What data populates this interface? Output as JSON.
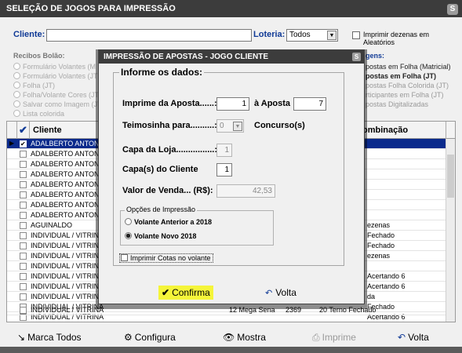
{
  "window": {
    "title": "SELEÇÃO DE JOGOS PARA IMPRESSÃO",
    "close_icon": "S"
  },
  "filters": {
    "cliente_label": "Cliente:",
    "cliente_value": "",
    "loteria_label": "Loteria:",
    "loteria_value": "Todos",
    "aleatorios_label": "Imprimir dezenas em Aleatórios"
  },
  "recibos": {
    "title": "Recibos Bolão:",
    "items": [
      "Formulário Volantes (M",
      "Formulário Volantes (JT",
      "Folha (JT)",
      "Folha/Volante Cores (JT",
      "Salvar como Imagem (JT",
      "Lista colorida"
    ]
  },
  "right_options": {
    "title_fragment": "gens:",
    "items": [
      "postas em Folha (Matricial)",
      "postas em Folha (JT)",
      "postas Folha Colorida (JT)",
      "rticipantes em Folha (JT)",
      "postas Digitalizadas"
    ]
  },
  "grid": {
    "headers": {
      "cliente": "Cliente",
      "combinacao": "ombinação"
    },
    "rows": [
      {
        "name": "ADALBERTO ANTONIO",
        "right": "",
        "selected": true
      },
      {
        "name": "ADALBERTO ANTONIO",
        "right": ""
      },
      {
        "name": "ADALBERTO ANTONIO",
        "right": ""
      },
      {
        "name": "ADALBERTO ANTONIO",
        "right": ""
      },
      {
        "name": "ADALBERTO ANTONIO",
        "right": ""
      },
      {
        "name": "ADALBERTO ANTONIO",
        "right": ""
      },
      {
        "name": "ADALBERTO ANTONIO",
        "right": ""
      },
      {
        "name": "ADALBERTO ANTONIO",
        "right": ""
      },
      {
        "name": "AGUINALDO",
        "right": "ezenas"
      },
      {
        "name": "INDIVIDUAL / VITRINA",
        "right": "Fechado"
      },
      {
        "name": "INDIVIDUAL / VITRINA",
        "right": "Fechado"
      },
      {
        "name": "INDIVIDUAL / VITRINA",
        "right": "ezenas"
      },
      {
        "name": "INDIVIDUAL / VITRINA",
        "right": ""
      },
      {
        "name": "INDIVIDUAL / VITRINA",
        "right": "Acertando 6"
      },
      {
        "name": "INDIVIDUAL / VITRINA",
        "right": "Acertando 6"
      },
      {
        "name": "INDIVIDUAL / VITRINA",
        "right": "da"
      },
      {
        "name": "INDIVIDUAL / VITRINA",
        "right": "Fechado"
      },
      {
        "name": "INDIVIDUAL / VITRINA",
        "right": "Acertando 6"
      }
    ],
    "bottom_row": {
      "name": "INDIVIDUAL / VITRINA",
      "c2": "12  Mega Sena",
      "c3": "2369",
      "c4": "20  Terno Fechado"
    }
  },
  "buttons": {
    "marca_todos": "Marca Todos",
    "configura": "Configura",
    "mostra": "Mostra",
    "imprime": "Imprime",
    "volta": "Volta"
  },
  "modal": {
    "title": "IMPRESSÃO DE APOSTAS - JOGO CLIENTE",
    "close_icon": "S",
    "legend": "Informe os dados:",
    "imprime_label": "Imprime da Aposta......:",
    "imprime_value": "1",
    "a_aposta_label": "à Aposta",
    "a_aposta_value": "7",
    "teimosinha_label": "Teimosinha para..........:",
    "teimosinha_value": "0",
    "concursos_label": "Concurso(s)",
    "capa_loja_label": "Capa da Loja................:",
    "capa_loja_value": "1",
    "capa_cliente_label": "Capa(s) do Cliente",
    "capa_cliente_value": "1",
    "valor_label": "Valor de Venda... (R$):",
    "valor_value": "42,53",
    "opcoes_legend": "Opções de Impressão",
    "opcao_anterior": "Volante Anterior a 2018",
    "opcao_novo": "Volante Novo 2018",
    "cotas_label": "Imprimir Cotas no volante",
    "confirma": "Confirma",
    "volta": "Volta"
  },
  "colors": {
    "title_bar": "#3c3c3c",
    "label_blue": "#103a96",
    "selected_row": "#0a2a8c",
    "highlight": "#f5f53a"
  }
}
